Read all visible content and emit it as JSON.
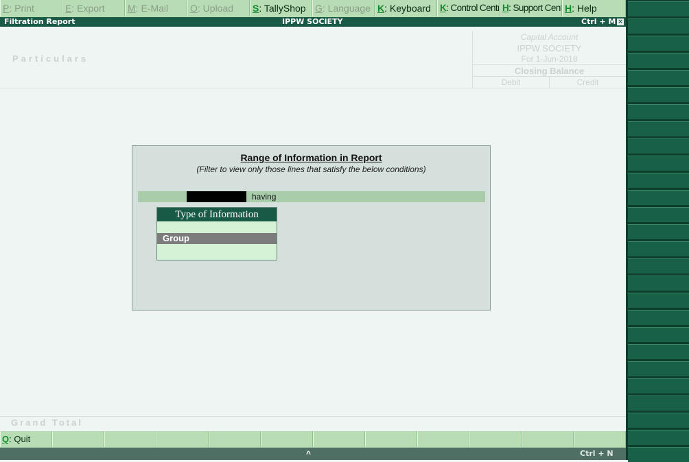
{
  "toolbar": [
    {
      "key": "P",
      "label": ": Print",
      "enabled": false
    },
    {
      "key": "E",
      "label": ": Export",
      "enabled": false
    },
    {
      "key": "M",
      "label": ": E-Mail",
      "enabled": false
    },
    {
      "key": "O",
      "label": ": Upload",
      "enabled": false
    },
    {
      "key": "S",
      "label": ": TallyShop",
      "enabled": true
    },
    {
      "key": "G",
      "label": ": Language",
      "enabled": false
    },
    {
      "key": "K",
      "label": ": Keyboard",
      "enabled": true
    },
    {
      "key": "K",
      "label": ": Control Centre",
      "enabled": true
    },
    {
      "key": "H",
      "label": ": Support Centre",
      "enabled": true
    },
    {
      "key": "H",
      "label": ": Help",
      "enabled": true
    }
  ],
  "titlebar": {
    "left": "Filtration Report",
    "center": "IPPW SOCIETY",
    "right": "Ctrl + M",
    "close": "×"
  },
  "report": {
    "particulars": "Particulars",
    "account_title": "Capital Account",
    "company": "IPPW SOCIETY",
    "period": "For 1-Jun-2018",
    "closing_balance": "Closing Balance",
    "debit": "Debit",
    "credit": "Credit",
    "grand_total": "Grand Total"
  },
  "dialog": {
    "title": "Range of Information in Report",
    "subtitle": "(Filter to view only those lines that satisfy the below conditions)",
    "field_value": "",
    "having": "having",
    "list_title": "Type of Information",
    "list_items": [
      "Group"
    ],
    "selected": "Group"
  },
  "bottombar": {
    "quit_key": "Q",
    "quit_label": ": Quit"
  },
  "statusbar": {
    "arrow": "^",
    "shortcut": "Ctrl + N"
  }
}
